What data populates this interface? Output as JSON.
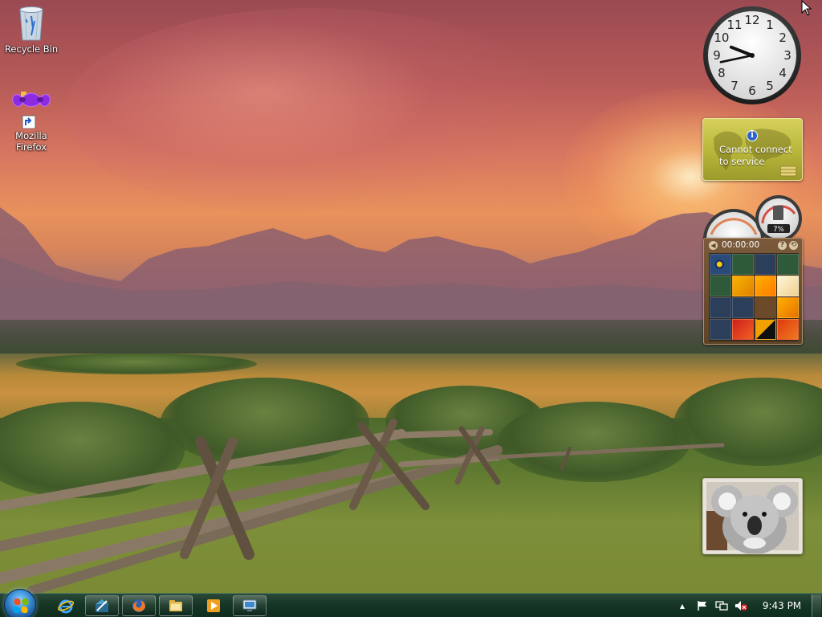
{
  "desktop": {
    "icons": [
      {
        "label": "Recycle Bin",
        "icon": "recycle-bin-icon"
      },
      {
        "label": "Mozilla Firefox",
        "icon": "firefox-shortcut-icon"
      }
    ]
  },
  "gadgets": {
    "clock": {
      "hour": 9,
      "minute": 43,
      "numerals": [
        "12",
        "1",
        "2",
        "3",
        "4",
        "5",
        "6",
        "7",
        "8",
        "9",
        "10",
        "11"
      ]
    },
    "weather": {
      "message": "Cannot connect to service"
    },
    "meter": {
      "cpu_label": "7%"
    },
    "puzzle": {
      "timer": "00:00:00",
      "help_label": "?",
      "prev_label": "◀",
      "solve_label": "⟲"
    },
    "slideshow": {
      "subject": "koala"
    }
  },
  "taskbar": {
    "buttons": [
      {
        "icon": "internet-explorer-icon"
      },
      {
        "icon": "app-icon"
      },
      {
        "icon": "firefox-icon"
      },
      {
        "icon": "windows-explorer-icon"
      },
      {
        "icon": "media-player-icon"
      },
      {
        "icon": "remote-desktop-icon"
      }
    ],
    "tray": {
      "show_hidden": "▲",
      "time": "9:43 PM"
    }
  },
  "colors": {
    "taskbar": "#163626",
    "weather_bg": "#b8b53a",
    "puzzle_bg": "#5e4328",
    "start_orb": "#3a8fd8"
  }
}
